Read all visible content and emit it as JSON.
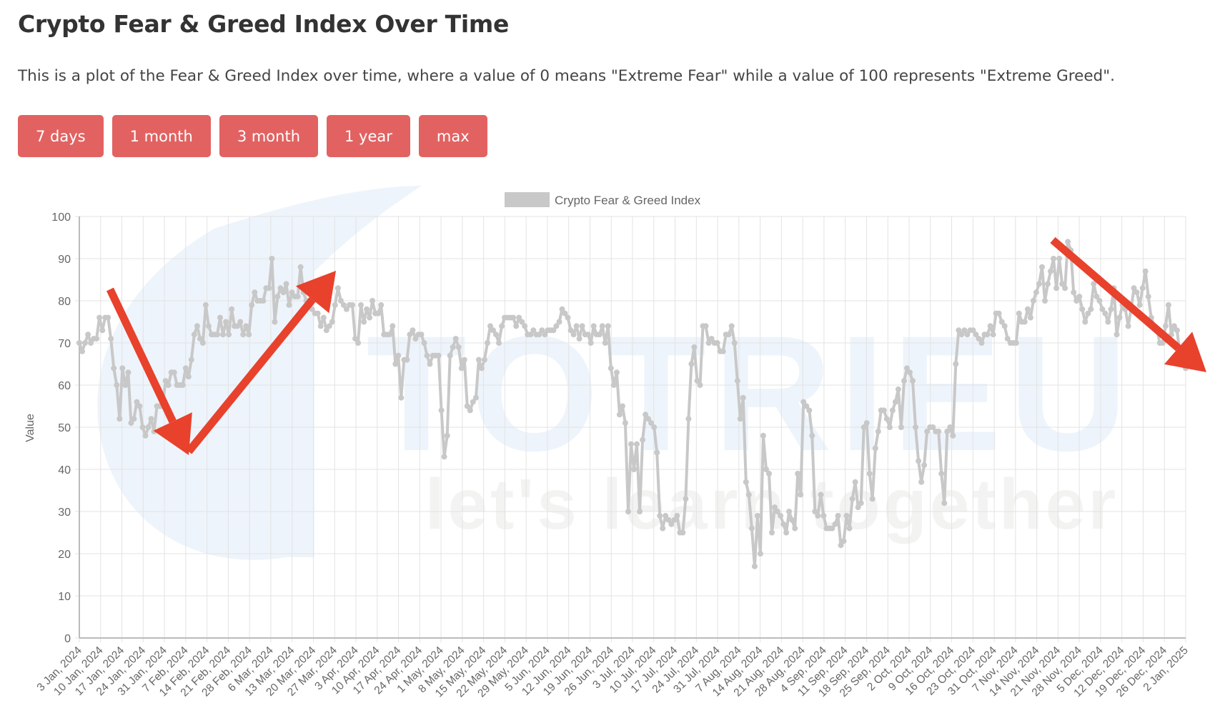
{
  "page": {
    "title": "Crypto Fear & Greed Index Over Time",
    "description": "This is a plot of the Fear & Greed Index over time, where a value of 0 means \"Extreme Fear\" while a value of 100 represents \"Extreme Greed\".",
    "buttons": [
      {
        "label": "7 days"
      },
      {
        "label": "1 month"
      },
      {
        "label": "3 month"
      },
      {
        "label": "1 year"
      },
      {
        "label": "max"
      }
    ],
    "accent_color": "#e26262",
    "watermark": {
      "brand": "TOTRIEU",
      "tagline": "let's learn together"
    },
    "annotation_arrows": [
      {
        "direction": "down",
        "meaning": "decline Jan–Feb 2024"
      },
      {
        "direction": "up",
        "meaning": "rise Feb–Mar 2024"
      },
      {
        "direction": "down",
        "meaning": "decline Nov 2024–Jan 2025"
      }
    ],
    "annotation_color": "#e8412c"
  },
  "chart_data": {
    "type": "line",
    "title": "",
    "legend": [
      {
        "label": "Crypto Fear & Greed Index",
        "color": "#c8c8c8"
      }
    ],
    "legend_position": "top-center",
    "xlabel": "",
    "ylabel": "Value",
    "ylim": [
      0,
      100
    ],
    "yticks": [
      0,
      10,
      20,
      30,
      40,
      50,
      60,
      70,
      80,
      90,
      100
    ],
    "grid": true,
    "start_date": "2024-01-03",
    "x_ticks": [
      "3 Jan, 2024",
      "10 Jan, 2024",
      "17 Jan, 2024",
      "24 Jan, 2024",
      "31 Jan, 2024",
      "7 Feb, 2024",
      "14 Feb, 2024",
      "21 Feb, 2024",
      "28 Feb, 2024",
      "6 Mar, 2024",
      "13 Mar, 2024",
      "20 Mar, 2024",
      "27 Mar, 2024",
      "3 Apr, 2024",
      "10 Apr, 2024",
      "17 Apr, 2024",
      "24 Apr, 2024",
      "1 May, 2024",
      "8 May, 2024",
      "15 May, 2024",
      "22 May, 2024",
      "29 May, 2024",
      "5 Jun, 2024",
      "12 Jun, 2024",
      "19 Jun, 2024",
      "26 Jun, 2024",
      "3 Jul, 2024",
      "10 Jul, 2024",
      "17 Jul, 2024",
      "24 Jul, 2024",
      "31 Jul, 2024",
      "7 Aug, 2024",
      "14 Aug, 2024",
      "21 Aug, 2024",
      "28 Aug, 2024",
      "4 Sep, 2024",
      "11 Sep, 2024",
      "18 Sep, 2024",
      "25 Sep, 2024",
      "2 Oct, 2024",
      "9 Oct, 2024",
      "16 Oct, 2024",
      "23 Oct, 2024",
      "31 Oct, 2024",
      "7 Nov, 2024",
      "14 Nov, 2024",
      "21 Nov, 2024",
      "28 Nov, 2024",
      "5 Dec, 2024",
      "12 Dec, 2024",
      "19 Dec, 2024",
      "26 Dec, 2024",
      "2 Jan, 2025"
    ],
    "series": [
      {
        "name": "Crypto Fear & Greed Index",
        "color": "#c8c8c8",
        "values": [
          70,
          68,
          70,
          72,
          70,
          71,
          71,
          76,
          73,
          76,
          76,
          71,
          64,
          60,
          52,
          64,
          60,
          63,
          51,
          52,
          56,
          55,
          50,
          48,
          50,
          52,
          49,
          55,
          55,
          55,
          61,
          60,
          63,
          63,
          60,
          60,
          60,
          64,
          62,
          66,
          72,
          74,
          71,
          70,
          79,
          74,
          72,
          72,
          72,
          76,
          72,
          75,
          72,
          78,
          74,
          74,
          75,
          72,
          74,
          72,
          79,
          82,
          80,
          80,
          80,
          83,
          83,
          90,
          75,
          81,
          83,
          82,
          84,
          79,
          82,
          81,
          81,
          88,
          82,
          80,
          80,
          78,
          77,
          77,
          74,
          76,
          73,
          74,
          75,
          79,
          83,
          80,
          79,
          78,
          79,
          79,
          71,
          70,
          79,
          75,
          78,
          76,
          80,
          77,
          77,
          79,
          72,
          72,
          72,
          74,
          65,
          67,
          57,
          66,
          66,
          72,
          73,
          71,
          72,
          72,
          70,
          67,
          65,
          67,
          67,
          67,
          54,
          43,
          48,
          67,
          69,
          71,
          69,
          64,
          66,
          55,
          54,
          56,
          57,
          66,
          64,
          66,
          70,
          74,
          73,
          72,
          70,
          74,
          76,
          76,
          76,
          76,
          74,
          76,
          75,
          74,
          72,
          72,
          73,
          72,
          72,
          73,
          72,
          73,
          73,
          73,
          74,
          75,
          78,
          77,
          76,
          73,
          72,
          74,
          71,
          74,
          72,
          72,
          70,
          74,
          72,
          72,
          74,
          70,
          74,
          64,
          60,
          63,
          53,
          55,
          51,
          30,
          46,
          40,
          46,
          30,
          47,
          53,
          52,
          51,
          50,
          44,
          29,
          26,
          29,
          28,
          27,
          28,
          29,
          25,
          25,
          33,
          52,
          65,
          69,
          61,
          60,
          74,
          74,
          70,
          71,
          70,
          70,
          68,
          68,
          72,
          72,
          74,
          70,
          61,
          52,
          57,
          37,
          34,
          26,
          17,
          29,
          20,
          48,
          40,
          39,
          25,
          31,
          30,
          29,
          27,
          25,
          30,
          28,
          26,
          39,
          34,
          56,
          55,
          54,
          48,
          30,
          29,
          34,
          29,
          26,
          26,
          26,
          27,
          29,
          22,
          23,
          29,
          26,
          33,
          37,
          31,
          32,
          50,
          51,
          39,
          33,
          45,
          49,
          54,
          54,
          52,
          50,
          54,
          56,
          59,
          50,
          61,
          64,
          63,
          61,
          50,
          42,
          37,
          41,
          49,
          50,
          50,
          49,
          49,
          39,
          32,
          49,
          50,
          48,
          65,
          73,
          72,
          73,
          72,
          73,
          73,
          72,
          71,
          70,
          72,
          72,
          74,
          72,
          77,
          77,
          75,
          74,
          71,
          70,
          70,
          70,
          77,
          75,
          75,
          78,
          76,
          80,
          82,
          84,
          88,
          80,
          84,
          87,
          90,
          83,
          90,
          84,
          83,
          94,
          92,
          82,
          80,
          81,
          78,
          75,
          77,
          78,
          84,
          81,
          80,
          78,
          77,
          75,
          78,
          83,
          72,
          76,
          79,
          78,
          74,
          78,
          83,
          82,
          79,
          83,
          87,
          81,
          76,
          74,
          73,
          70,
          70,
          74,
          79,
          72,
          74,
          73,
          67,
          65,
          64
        ]
      }
    ]
  }
}
